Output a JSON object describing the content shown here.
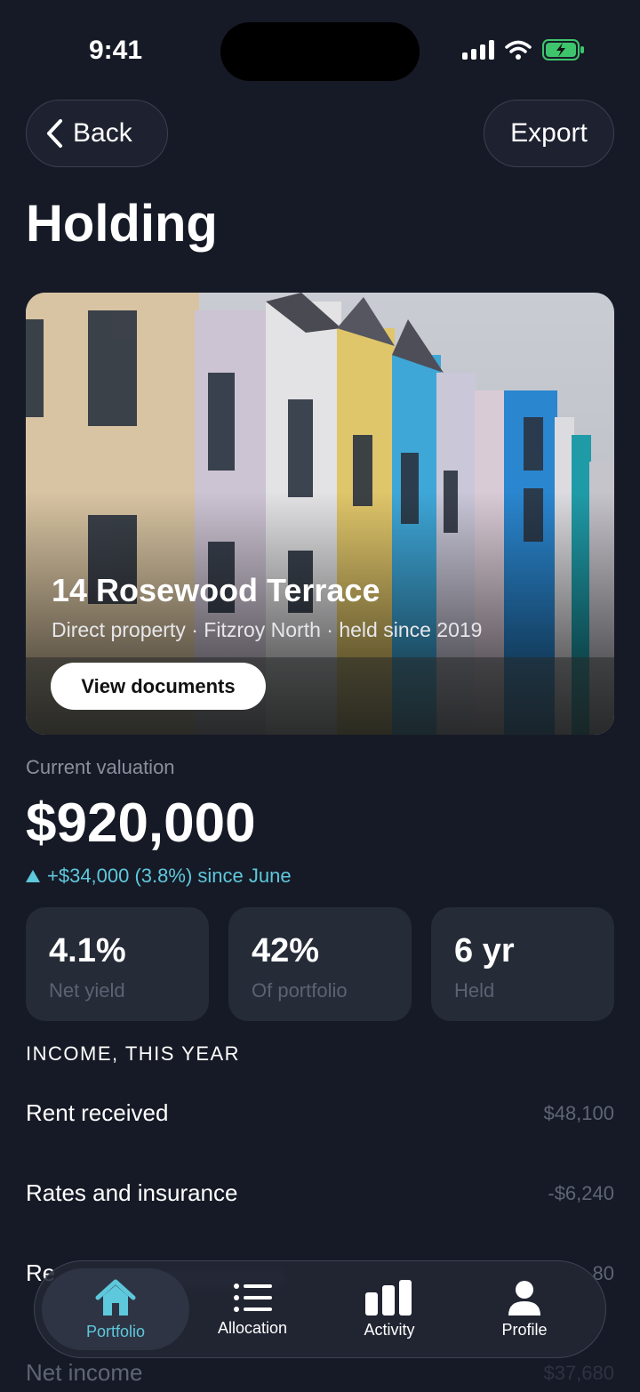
{
  "status_bar": {
    "time": "9:41"
  },
  "nav": {
    "back_label": "Back",
    "export_label": "Export"
  },
  "page_title": "Holding",
  "hero": {
    "title": "14 Rosewood Terrace",
    "subtitle": "Direct property · Fitzroy North · held since 2019",
    "button_label": "View documents"
  },
  "valuation": {
    "label": "Current valuation",
    "amount": "$920,000",
    "change": "+$34,000 (3.8%) since June"
  },
  "stats": [
    {
      "value": "4.1%",
      "label": "Net yield"
    },
    {
      "value": "42%",
      "label": "Of portfolio"
    },
    {
      "value": "6 yr",
      "label": "Held"
    }
  ],
  "income": {
    "heading": "INCOME, THIS YEAR",
    "rows": [
      {
        "name": "Rent received",
        "amount": "$48,100"
      },
      {
        "name": "Rates and insurance",
        "amount": "-$6,240"
      },
      {
        "name": "Re",
        "amount": "80"
      },
      {
        "name": "Net income",
        "amount": "$37,680"
      }
    ]
  },
  "tabbar": {
    "tabs": [
      {
        "label": "Portfolio",
        "icon": "home-icon",
        "active": true
      },
      {
        "label": "Allocation",
        "icon": "list-icon",
        "active": false
      },
      {
        "label": "Activity",
        "icon": "bar-chart-icon",
        "active": false
      },
      {
        "label": "Profile",
        "icon": "person-icon",
        "active": false
      }
    ]
  },
  "colors": {
    "background": "#161a26",
    "accent": "#5ec8dc",
    "card": "#262b38"
  }
}
